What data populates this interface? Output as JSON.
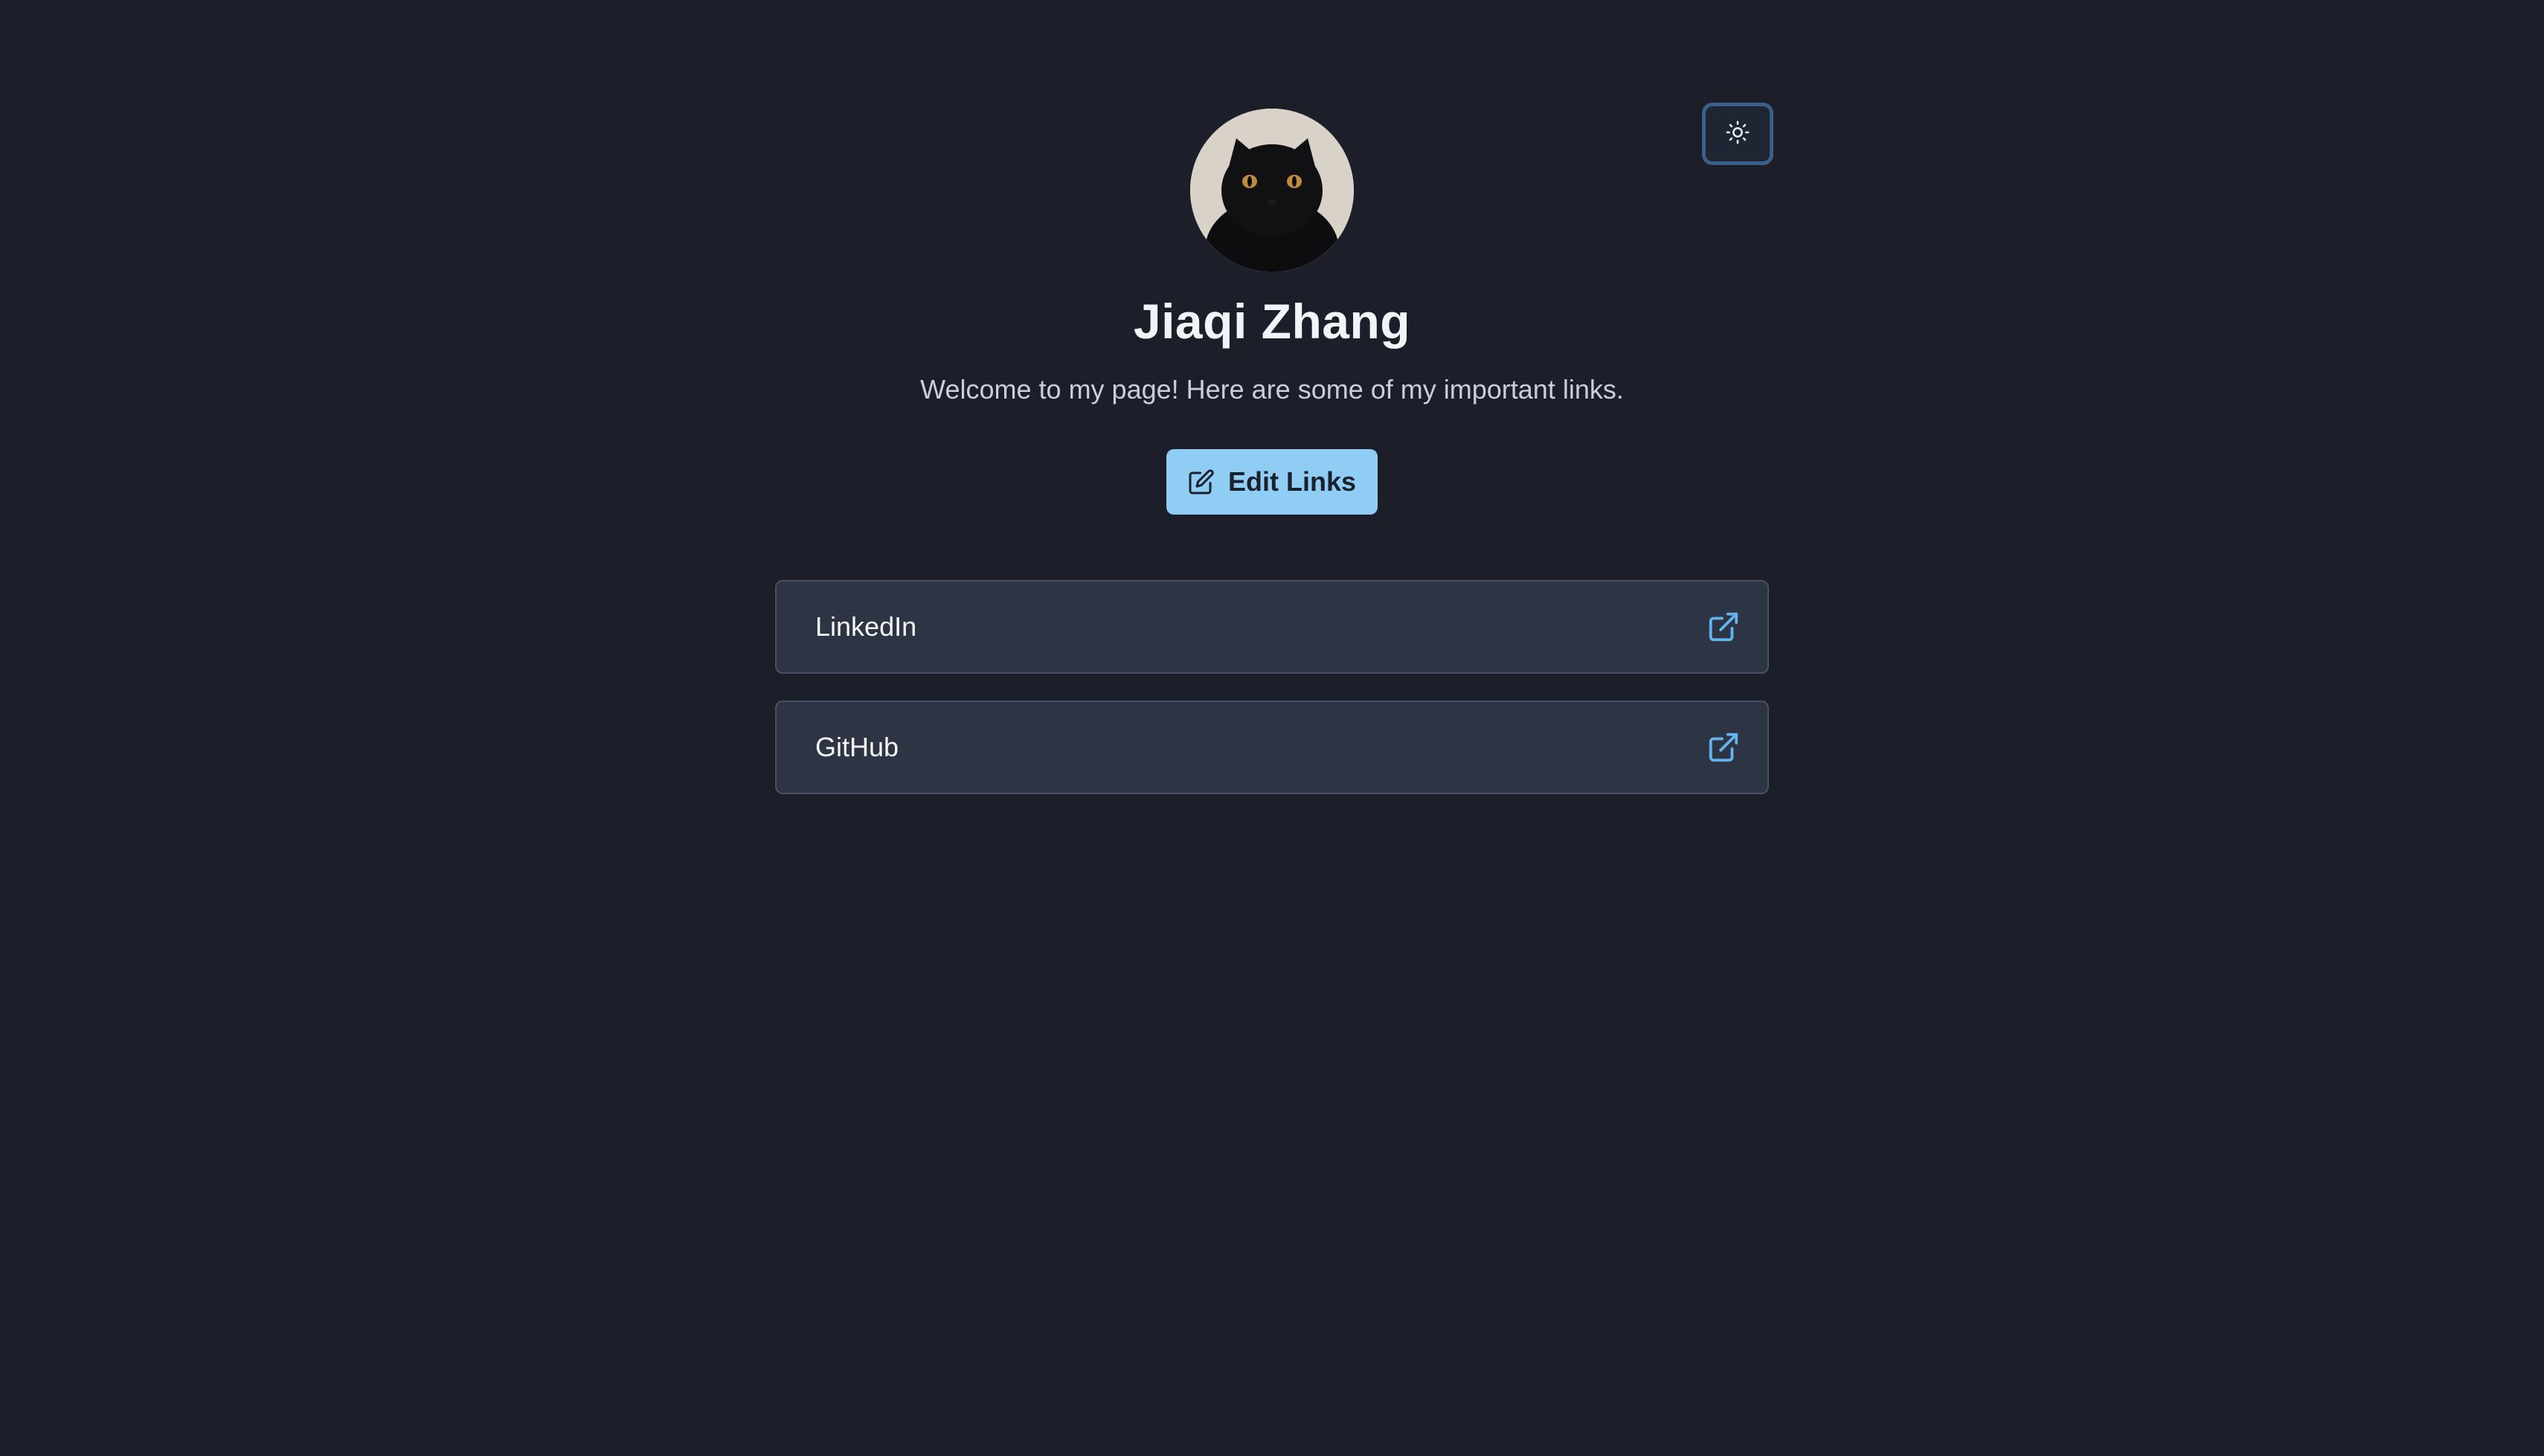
{
  "profile": {
    "name": "Jiaqi Zhang",
    "bio": "Welcome to my page! Here are some of my important links.",
    "avatar_icon": "cat-avatar"
  },
  "actions": {
    "edit_label": "Edit Links",
    "edit_icon": "edit-icon",
    "theme_icon": "sun-icon"
  },
  "links": [
    {
      "label": "LinkedIn",
      "icon": "external-link-icon"
    },
    {
      "label": "GitHub",
      "icon": "external-link-icon"
    }
  ],
  "colors": {
    "background": "#1c1f29",
    "card": "#2d3444",
    "accent": "#90cdf4",
    "link_icon": "#63b3ed",
    "toggle_border": "#3b5f89"
  }
}
